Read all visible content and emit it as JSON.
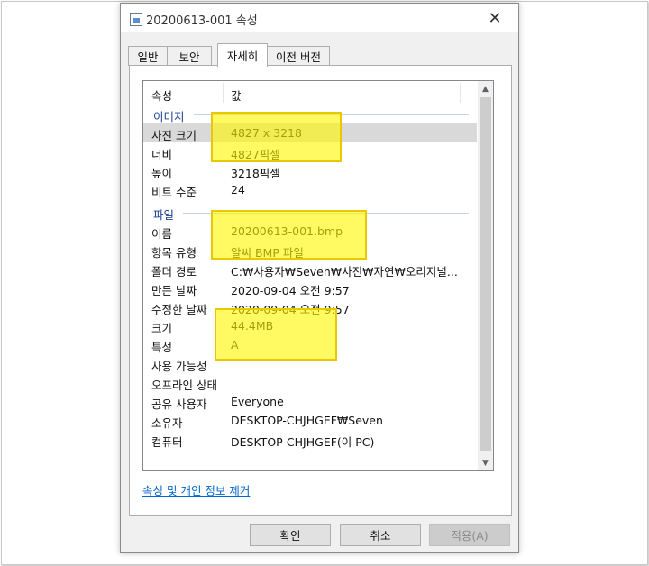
{
  "window": {
    "title": "20200613-001 속성",
    "close_glyph": "✕"
  },
  "tabs": [
    {
      "label": "일반",
      "active": false
    },
    {
      "label": "보안",
      "active": false
    },
    {
      "label": "자세히",
      "active": true
    },
    {
      "label": "이전 버전",
      "active": false
    }
  ],
  "list": {
    "headers": {
      "property": "속성",
      "value": "값"
    },
    "groups": {
      "image": {
        "title": "이미지",
        "rows": [
          {
            "property": "사진 크기",
            "value": "4827 x 3218"
          },
          {
            "property": "너비",
            "value": "4827픽셀"
          },
          {
            "property": "높이",
            "value": "3218픽셀"
          },
          {
            "property": "비트 수준",
            "value": "24"
          }
        ]
      },
      "file": {
        "title": "파일",
        "rows": [
          {
            "property": "이름",
            "value": "20200613-001.bmp"
          },
          {
            "property": "항목 유형",
            "value": "알씨 BMP 파일"
          },
          {
            "property": "폴더 경로",
            "value": "C:₩사용자₩Seven₩사진₩자연₩오리지널..."
          },
          {
            "property": "만든 날짜",
            "value": "2020-09-04 오전 9:57"
          },
          {
            "property": "수정한 날짜",
            "value": "2020-09-04 오전 9:57"
          },
          {
            "property": "크기",
            "value": "44.4MB"
          },
          {
            "property": "특성",
            "value": "A"
          },
          {
            "property": "사용 가능성",
            "value": ""
          },
          {
            "property": "오프라인 상태",
            "value": ""
          },
          {
            "property": "공유 사용자",
            "value": "Everyone"
          },
          {
            "property": "소유자",
            "value": "DESKTOP-CHJHGEF₩Seven"
          },
          {
            "property": "컴퓨터",
            "value": "DESKTOP-CHJHGEF(이 PC)"
          }
        ]
      }
    }
  },
  "remove_link": "속성 및 개인 정보 제거",
  "buttons": {
    "ok": "확인",
    "cancel": "취소",
    "apply": "적용(A)"
  },
  "colors": {
    "highlight": "#fff700",
    "link": "#0066cc",
    "group_title": "#1a3f91"
  }
}
